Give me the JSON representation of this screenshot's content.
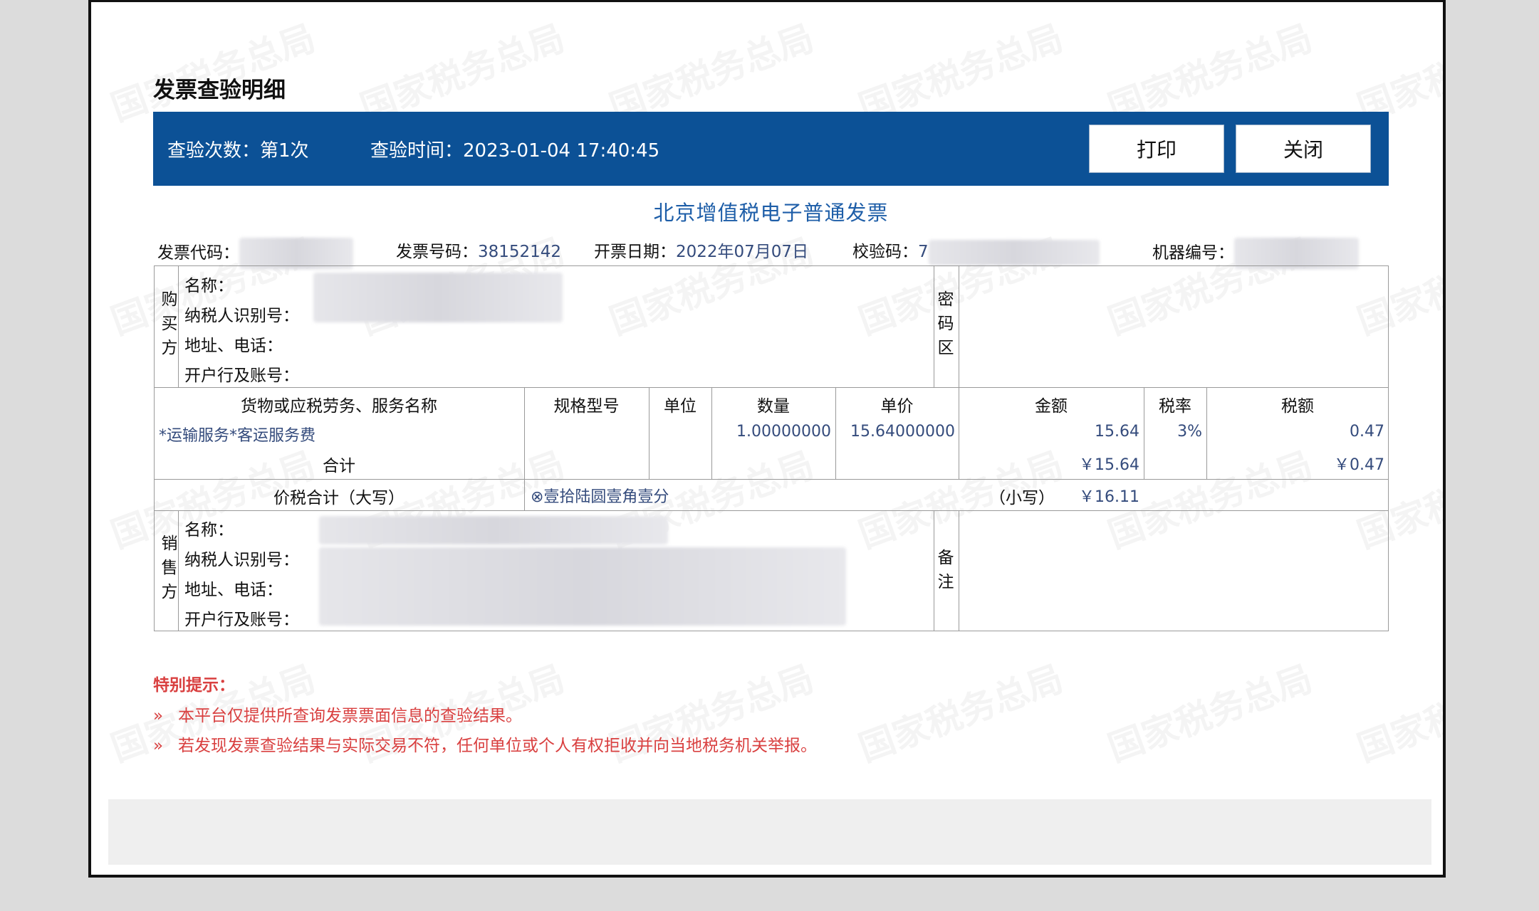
{
  "page": {
    "title": "发票查验明细",
    "watermark_text": "国家税务总局"
  },
  "bar": {
    "count_label": "查验次数：第1次",
    "time_label": "查验时间：2023-01-04 17:40:45",
    "print_label": "打印",
    "close_label": "关闭"
  },
  "invoice": {
    "title": "北京增值税电子普通发票",
    "code_label": "发票代码：",
    "number_label": "发票号码：",
    "number_value": "38152142",
    "date_label": "开票日期：",
    "date_value": "2022年07月07日",
    "check_label": "校验码：",
    "check_value_prefix": "7",
    "machine_label": "机器编号：",
    "buyer": {
      "side_label": "购买方",
      "name_label": "名称：",
      "tax_id_label": "纳税人识别号：",
      "address_label": "地址、电话：",
      "bank_label": "开户行及账号："
    },
    "password_area_label": "密码区",
    "items": {
      "headers": [
        "货物或应税劳务、服务名称",
        "规格型号",
        "单位",
        "数量",
        "单价",
        "金额",
        "税率",
        "税额"
      ],
      "rows": [
        {
          "name": "*运输服务*客运服务费",
          "spec": "",
          "unit": "",
          "qty": "1.00000000",
          "price": "15.64000000",
          "amount": "15.64",
          "rate": "3%",
          "tax": "0.47"
        }
      ],
      "total_label": "合计",
      "total_amount": "￥15.64",
      "total_tax": "￥0.47"
    },
    "grand_total": {
      "label": "价税合计（大写）",
      "uppercase": "⊗壹拾陆圆壹角壹分",
      "lowercase_label": "（小写）",
      "lowercase_value": "￥16.11"
    },
    "seller": {
      "side_label": "销售方",
      "name_label": "名称：",
      "tax_id_label": "纳税人识别号：",
      "address_label": "地址、电话：",
      "bank_label": "开户行及账号："
    },
    "remark_label": "备注"
  },
  "notice": {
    "title": "特别提示：",
    "bullet": "»",
    "items": [
      "本平台仅提供所查询发票票面信息的查验结果。",
      "若发现发票查验结果与实际交易不符，任何单位或个人有权拒收并向当地税务机关举报。"
    ]
  },
  "colors": {
    "bar_bg": "#0c5196",
    "title_blue": "#1e5ea8",
    "value_blue": "#344b7c",
    "notice_red": "#d94040"
  }
}
